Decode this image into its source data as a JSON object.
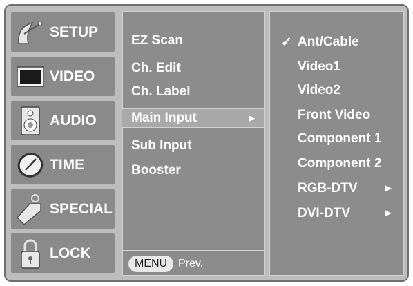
{
  "sidebar": {
    "items": [
      {
        "label": "SETUP",
        "icon": "satellite-dish-icon"
      },
      {
        "label": "VIDEO",
        "icon": "monitor-icon"
      },
      {
        "label": "AUDIO",
        "icon": "speaker-icon"
      },
      {
        "label": "TIME",
        "icon": "clock-icon"
      },
      {
        "label": "SPECIAL",
        "icon": "tag-icon"
      },
      {
        "label": "LOCK",
        "icon": "padlock-icon"
      }
    ]
  },
  "setup_menu": {
    "items": [
      "EZ Scan",
      "Ch. Edit",
      "Ch. Label",
      "Main Input",
      "Sub Input",
      "Booster"
    ],
    "selected": "Main Input",
    "arrow": "►"
  },
  "footer": {
    "menu_button": "MENU",
    "prev_label": "Prev."
  },
  "input_options": {
    "checkmark": "✓",
    "items": [
      {
        "label": "Ant/Cable",
        "checked": true
      },
      {
        "label": "Video1"
      },
      {
        "label": "Video2"
      },
      {
        "label": "Front Video"
      },
      {
        "label": "Component 1"
      },
      {
        "label": "Component 2"
      },
      {
        "label": "RGB-DTV",
        "submenu": "►"
      },
      {
        "label": "DVI-DTV",
        "submenu": "►"
      }
    ]
  }
}
